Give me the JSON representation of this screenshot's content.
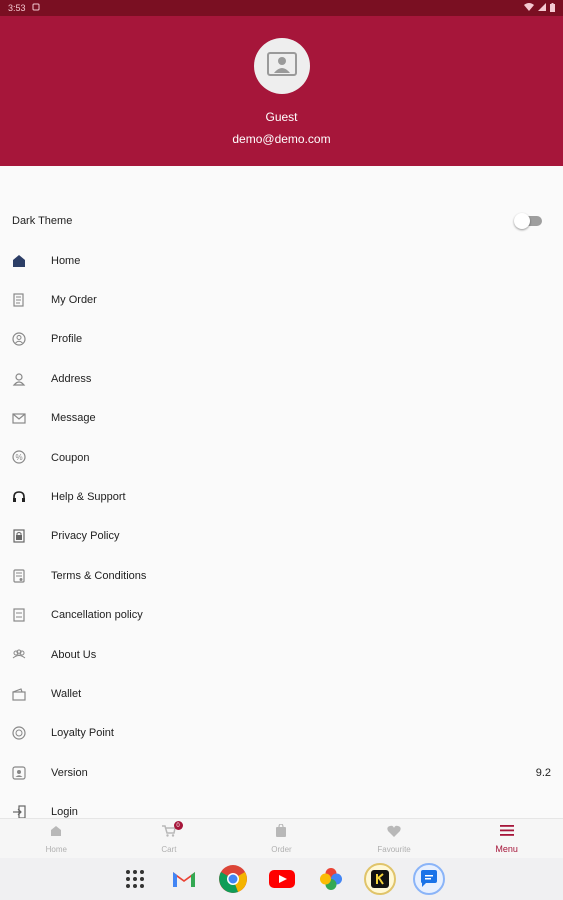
{
  "status_bar": {
    "time": "3:53"
  },
  "header": {
    "name": "Guest",
    "email": "demo@demo.com",
    "background_color": "#a6163a"
  },
  "theme_toggle": {
    "label": "Dark Theme",
    "enabled": false
  },
  "menu": {
    "items": [
      {
        "label": "Home",
        "icon": "home-icon"
      },
      {
        "label": "My Order",
        "icon": "order-icon"
      },
      {
        "label": "Profile",
        "icon": "profile-icon"
      },
      {
        "label": "Address",
        "icon": "address-icon"
      },
      {
        "label": "Message",
        "icon": "message-icon"
      },
      {
        "label": "Coupon",
        "icon": "coupon-icon"
      },
      {
        "label": "Help & Support",
        "icon": "headset-icon"
      },
      {
        "label": "Privacy Policy",
        "icon": "privacy-icon"
      },
      {
        "label": "Terms & Conditions",
        "icon": "terms-icon"
      },
      {
        "label": "Cancellation policy",
        "icon": "cancellation-icon"
      },
      {
        "label": "About Us",
        "icon": "about-icon"
      },
      {
        "label": "Wallet",
        "icon": "wallet-icon"
      },
      {
        "label": "Loyalty Point",
        "icon": "loyalty-icon"
      },
      {
        "label": "Version",
        "icon": "version-icon",
        "value": "9.2"
      },
      {
        "label": "Login",
        "icon": "login-icon"
      }
    ]
  },
  "bottom_nav": {
    "items": [
      {
        "label": "Home",
        "icon": "home-icon"
      },
      {
        "label": "Cart",
        "icon": "cart-icon",
        "badge": "0"
      },
      {
        "label": "Order",
        "icon": "order-bag-icon"
      },
      {
        "label": "Favourite",
        "icon": "heart-icon"
      },
      {
        "label": "Menu",
        "icon": "menu-icon",
        "active": true
      }
    ],
    "active_color": "#a6163a"
  },
  "dock": {
    "apps": [
      "app-drawer-icon",
      "gmail-icon",
      "chrome-icon",
      "youtube-icon",
      "photos-icon",
      "keep-icon",
      "messages-icon"
    ]
  }
}
